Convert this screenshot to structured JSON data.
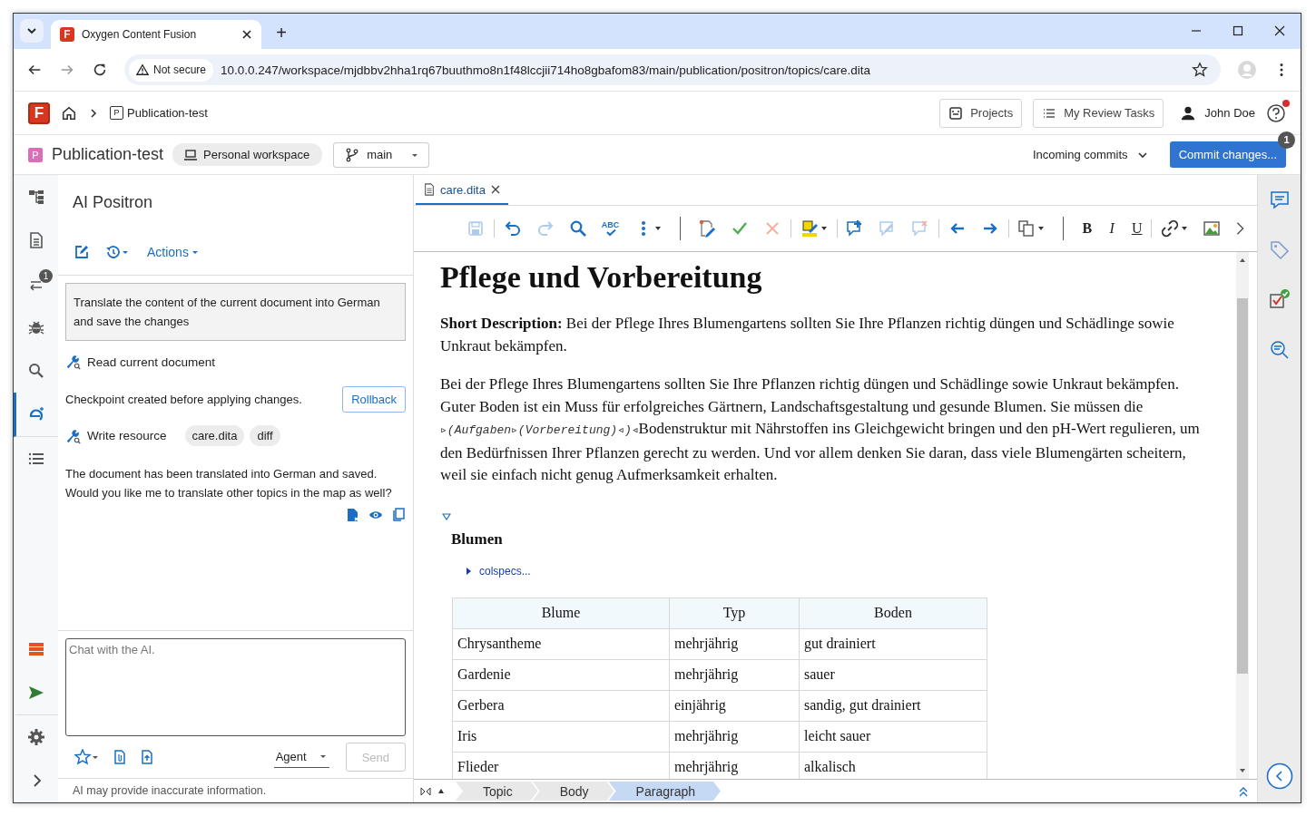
{
  "browser": {
    "tabs": [
      {
        "favicon_letter": "F",
        "title": "Oxygen Content Fusion",
        "selected": true
      }
    ],
    "new_tab": "+",
    "security_chip": "Not secure",
    "url": "10.0.0.247/workspace/mjdbbv2hha1rq67buuthmo8n1f48lccjii714ho8gbafom83/main/publication/positron/topics/care.dita"
  },
  "app_header": {
    "logo_letter": "F",
    "breadcrumb_badge": "P",
    "breadcrumb": "Publication-test",
    "buttons": [
      "Projects",
      "My Review Tasks"
    ],
    "user": "John Doe",
    "help_notification": true
  },
  "project_bar": {
    "badge": "P",
    "name": "Publication-test",
    "workspace": "Personal workspace",
    "branch": "main",
    "incoming": "Incoming commits",
    "commit_button": "Commit changes...",
    "commit_count": "1"
  },
  "left_rail": {
    "items": [
      {
        "selected": false
      },
      {
        "selected": false
      },
      {
        "selected": false,
        "badge": "1"
      },
      {
        "selected": false
      },
      {
        "selected": false
      },
      {
        "selected": true
      },
      {
        "selected": false
      }
    ]
  },
  "ai_panel": {
    "title": "AI Positron",
    "actions": "Actions",
    "conversation": [
      {
        "kind": "prompt",
        "text": "Translate the content of the current document into German and save the changes"
      },
      {
        "kind": "tool",
        "label": "Read current document"
      },
      {
        "kind": "checkpoint",
        "text": "Checkpoint created before applying changes.",
        "button": "Rollback"
      },
      {
        "kind": "tool",
        "label": "Write resource",
        "chips": [
          "care.dita",
          "diff"
        ]
      },
      {
        "kind": "reply",
        "text": "The document has been translated into German and saved. Would you like me to translate other topics in the map as well?"
      }
    ],
    "chat": {
      "placeholder": "Chat with the AI.",
      "mode": "Agent",
      "send": "Send",
      "send_disabled": true
    },
    "footer": "AI may provide inaccurate information."
  },
  "editor": {
    "tabs": [
      {
        "label": "care.dita",
        "selected": true
      }
    ],
    "toolbar": [
      {
        "disabled": true
      },
      {
        "disabled": false
      },
      {
        "disabled": true
      },
      {
        "disabled": false
      },
      {
        "label": "ABC",
        "disabled": false
      },
      {
        "disabled": false
      },
      {
        "disabled": false
      },
      {
        "disabled": false
      },
      {
        "disabled": true
      },
      {
        "disabled": false
      },
      {
        "disabled": false
      },
      {
        "disabled": true
      },
      {
        "disabled": true
      },
      {
        "disabled": false
      },
      {
        "disabled": false
      },
      {
        "disabled": false
      },
      {
        "label": "B",
        "disabled": false
      },
      {
        "label": "I",
        "disabled": false
      },
      {
        "label": "U",
        "disabled": false
      },
      {
        "disabled": false
      },
      {
        "disabled": false
      }
    ],
    "document": {
      "title": "Pflege und Vorbereitung",
      "short_description": "**Short Description:** Bei der Pflege Ihres Blumengartens sollten Sie Ihre Pflanzen richtig düngen und Schädlinge sowie Unkraut bekämpfen.",
      "paragraph": [
        {
          "kind": "text",
          "text": "Bei der Pflege Ihres Blumengartens sollten Sie Ihre Pflanzen richtig düngen und Schädlinge sowie Unkraut bekämpfen. Guter Boden ist ein Muss für erfolgreiches Gärtnern, Landschaftsgestaltung und gesunde Blumen. Sie müssen die "
        },
        {
          "kind": "tag",
          "text": "▹(Aufgaben▹(Vorbereitung)◃)◃"
        },
        {
          "kind": "text",
          "text": "Bodenstruktur mit Nährstoffen ins Gleichgewicht bringen und den pH-Wert regulieren, um den Bedürfnissen Ihrer Pflanzen gerecht zu werden. Und vor allem denken Sie daran, dass viele Blumengärten scheitern, weil sie einfach nicht genug Aufmerksamkeit erhalten."
        }
      ],
      "section": {
        "expanded": true,
        "title": "Blumen",
        "colspecs": "colspecs...",
        "table": {
          "columns": [
            "Blume",
            "Typ",
            "Boden"
          ],
          "rows": [
            [
              "Chrysantheme",
              "mehrjährig",
              "gut drainiert"
            ],
            [
              "Gardenie",
              "mehrjährig",
              "sauer"
            ],
            [
              "Gerbera",
              "einjährig",
              "sandig, gut drainiert"
            ],
            [
              "Iris",
              "mehrjährig",
              "leicht sauer"
            ],
            [
              "Flieder",
              "mehrjährig",
              "alkalisch"
            ]
          ]
        }
      }
    },
    "breadcrumbs": [
      {
        "label": "Topic",
        "selected": false
      },
      {
        "label": "Body",
        "selected": false
      },
      {
        "label": "Paragraph",
        "selected": true
      }
    ]
  }
}
